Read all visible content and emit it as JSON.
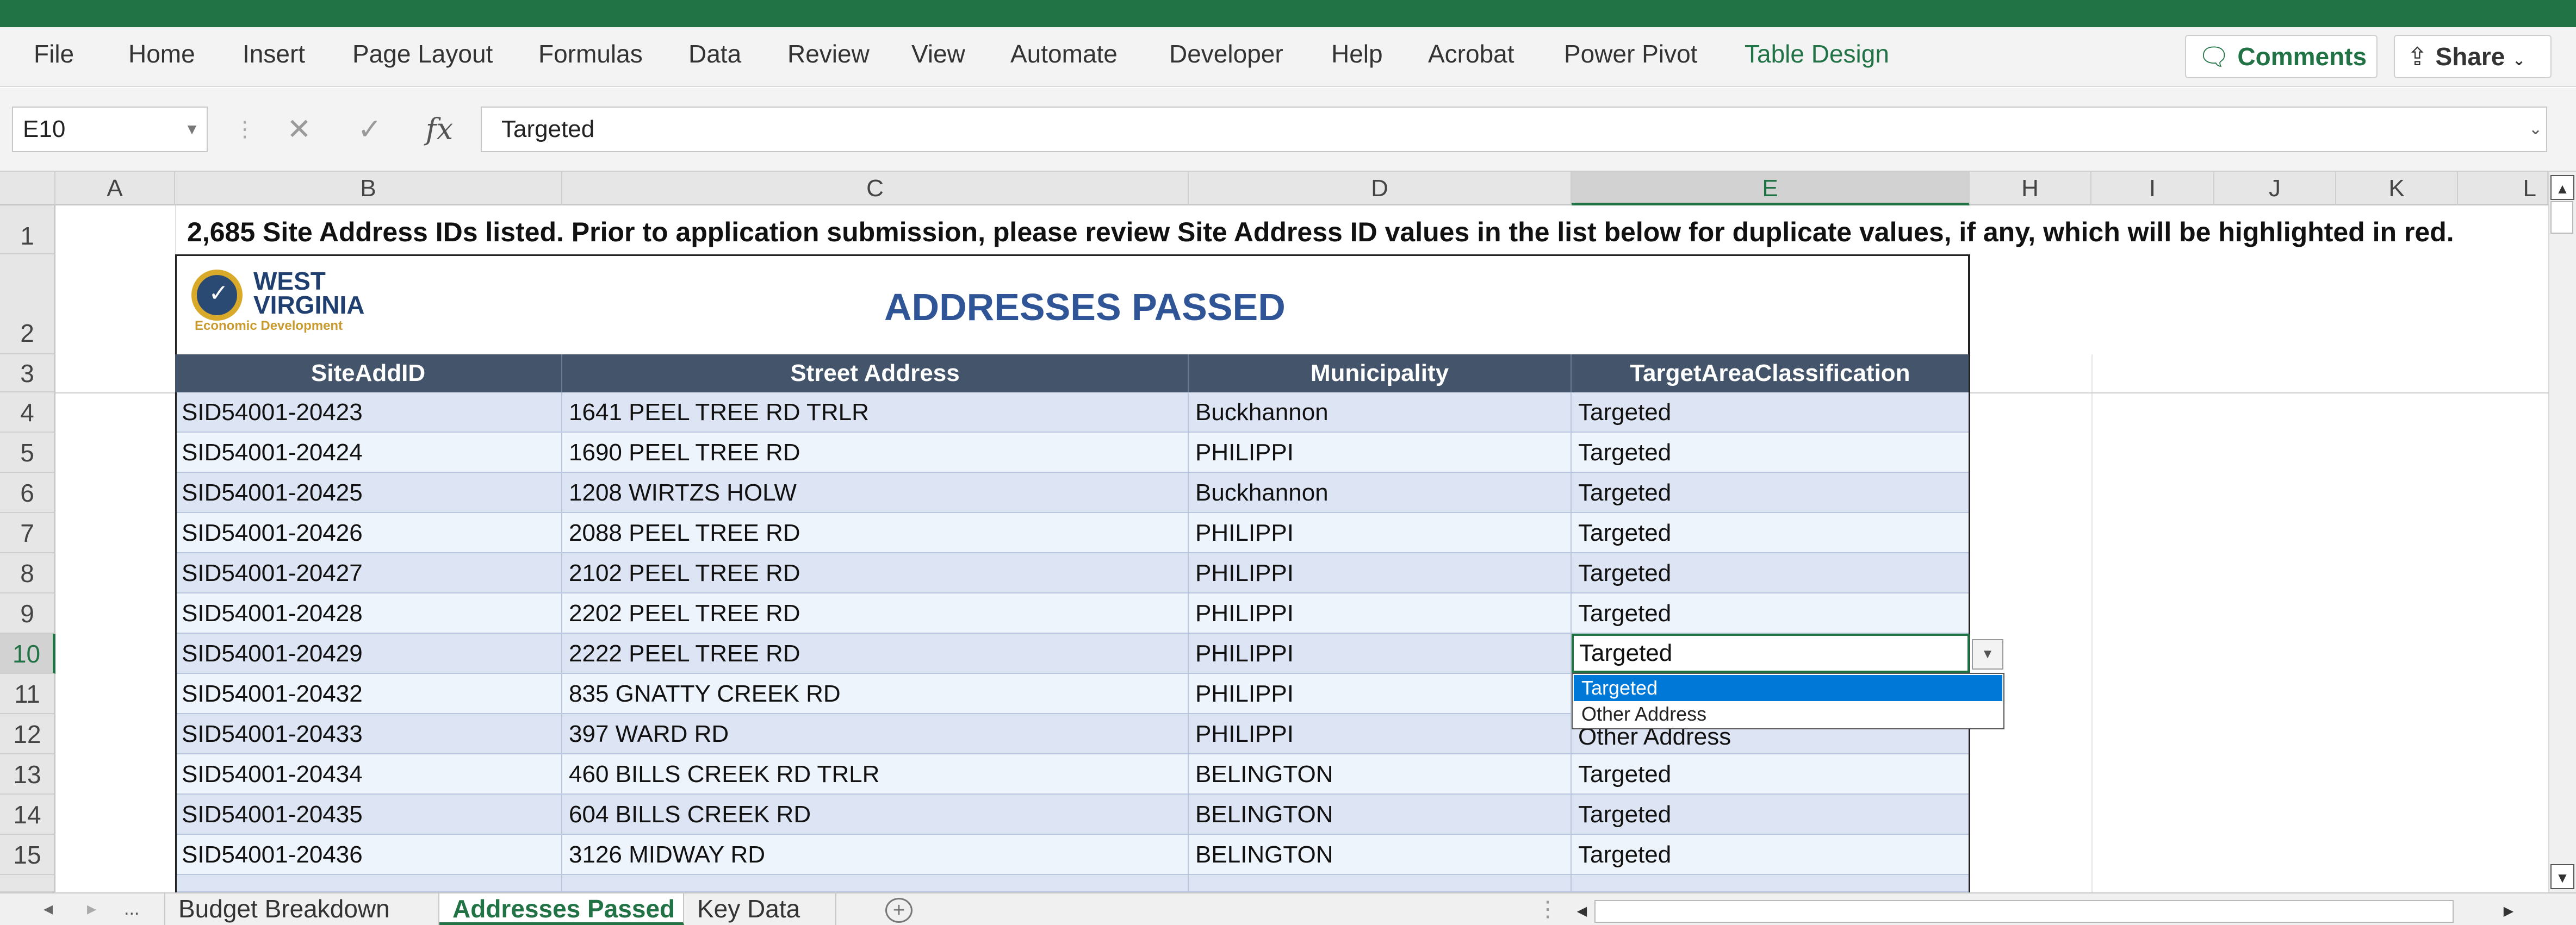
{
  "ribbon": {
    "tabs": [
      "File",
      "Home",
      "Insert",
      "Page Layout",
      "Formulas",
      "Data",
      "Review",
      "View",
      "Automate",
      "Developer",
      "Help",
      "Acrobat",
      "Power Pivot",
      "Table Design"
    ],
    "comments_label": "Comments",
    "share_label": "Share"
  },
  "formula_bar": {
    "name_box": "E10",
    "cancel_glyph": "✕",
    "enter_glyph": "✓",
    "fx_label": "fx",
    "content": "Targeted"
  },
  "columns": [
    "A",
    "B",
    "C",
    "D",
    "E",
    "H",
    "I",
    "J",
    "K",
    "L"
  ],
  "rows": [
    "1",
    "2",
    "3",
    "4",
    "5",
    "6",
    "7",
    "8",
    "9",
    "10",
    "11",
    "12",
    "13",
    "14",
    "15"
  ],
  "notice": "2,685 Site Address IDs listed.   Prior to application submission, please review Site Address ID values in the list below for duplicate values, if any, which will be highlighted in red.",
  "logo": {
    "line1": "WEST",
    "line2": "VIRGINIA",
    "line3": "Economic Development"
  },
  "banner_title": "ADDRESSES PASSED",
  "table": {
    "headers": [
      "SiteAddID",
      "Street Address",
      "Municipality",
      "TargetAreaClassification"
    ],
    "rows": [
      {
        "id": "SID54001-20423",
        "street": "1641 PEEL TREE RD TRLR",
        "municipality": "Buckhannon",
        "classification": "Targeted"
      },
      {
        "id": "SID54001-20424",
        "street": "1690 PEEL TREE RD",
        "municipality": "PHILIPPI",
        "classification": "Targeted"
      },
      {
        "id": "SID54001-20425",
        "street": "1208 WIRTZS HOLW",
        "municipality": "Buckhannon",
        "classification": "Targeted"
      },
      {
        "id": "SID54001-20426",
        "street": "2088 PEEL TREE RD",
        "municipality": "PHILIPPI",
        "classification": "Targeted"
      },
      {
        "id": "SID54001-20427",
        "street": "2102 PEEL TREE RD",
        "municipality": "PHILIPPI",
        "classification": "Targeted"
      },
      {
        "id": "SID54001-20428",
        "street": "2202 PEEL TREE RD",
        "municipality": "PHILIPPI",
        "classification": "Targeted"
      },
      {
        "id": "SID54001-20429",
        "street": "2222 PEEL TREE RD",
        "municipality": "PHILIPPI",
        "classification": "Targeted"
      },
      {
        "id": "SID54001-20432",
        "street": "835 GNATTY CREEK RD",
        "municipality": "PHILIPPI",
        "classification": ""
      },
      {
        "id": "SID54001-20433",
        "street": "397 WARD RD",
        "municipality": "PHILIPPI",
        "classification": "Other Address"
      },
      {
        "id": "SID54001-20434",
        "street": "460 BILLS CREEK RD TRLR",
        "municipality": "BELINGTON",
        "classification": "Targeted"
      },
      {
        "id": "SID54001-20435",
        "street": "604 BILLS CREEK RD",
        "municipality": "BELINGTON",
        "classification": "Targeted"
      },
      {
        "id": "SID54001-20436",
        "street": "3126 MIDWAY RD",
        "municipality": "BELINGTON",
        "classification": "Targeted"
      }
    ]
  },
  "dropdown": {
    "selected_value": "Targeted",
    "options": [
      "Targeted",
      "Other Address"
    ],
    "highlighted_index": 0
  },
  "sheet_tabs": {
    "more_label": "...",
    "tabs": [
      "Budget Breakdown",
      "Addresses Passed",
      "Key Data"
    ],
    "active": "Addresses Passed"
  },
  "colors": {
    "excel_green": "#217346",
    "header_fill": "#44546a",
    "banner_title": "#2f5597",
    "row_odd": "#dde4f3",
    "row_even": "#eef4fb",
    "dropdown_highlight": "#0078d7"
  }
}
